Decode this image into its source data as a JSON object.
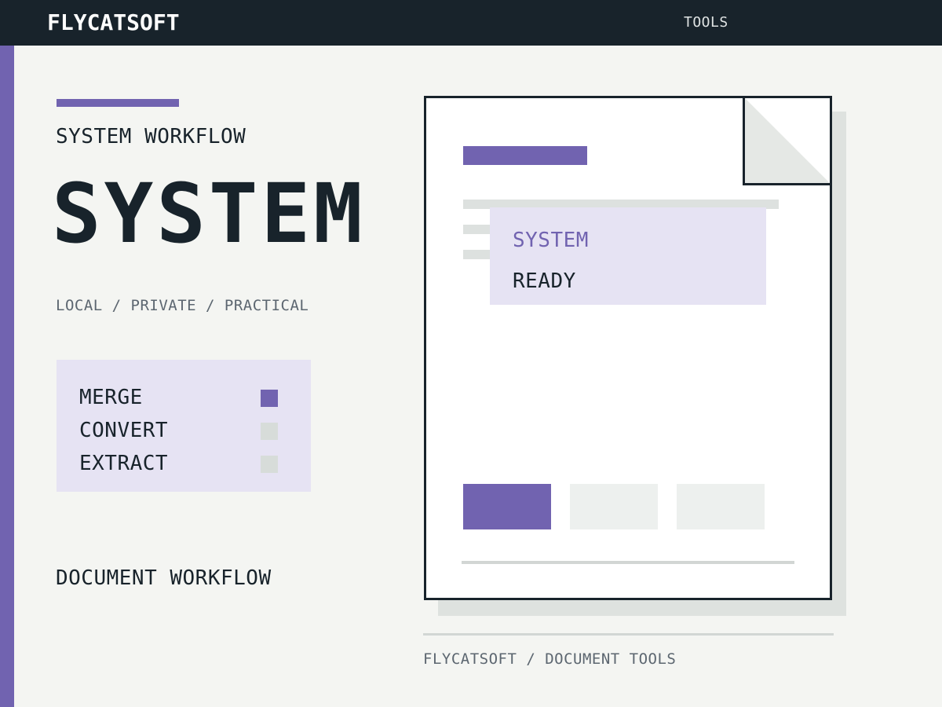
{
  "header": {
    "brand": "FLYCATSOFT",
    "nav_tools": "TOOLS"
  },
  "colors": {
    "accent": "#7163b0",
    "dark": "#18232b",
    "panel": "#e6e3f3",
    "inactive": "#d7dcd9",
    "background": "#f4f5f2"
  },
  "hero": {
    "eyebrow": "SYSTEM WORKFLOW",
    "title": "SYSTEM",
    "tagline": "LOCAL / PRIVATE / PRACTICAL"
  },
  "menu": {
    "items": [
      {
        "label": "MERGE",
        "active": true
      },
      {
        "label": "CONVERT",
        "active": false
      },
      {
        "label": "EXTRACT",
        "active": false
      }
    ]
  },
  "footer": {
    "left_label": "DOCUMENT WORKFLOW",
    "caption": "FLYCATSOFT / DOCUMENT TOOLS"
  },
  "document": {
    "status_line1": "SYSTEM",
    "status_line2": "READY"
  }
}
